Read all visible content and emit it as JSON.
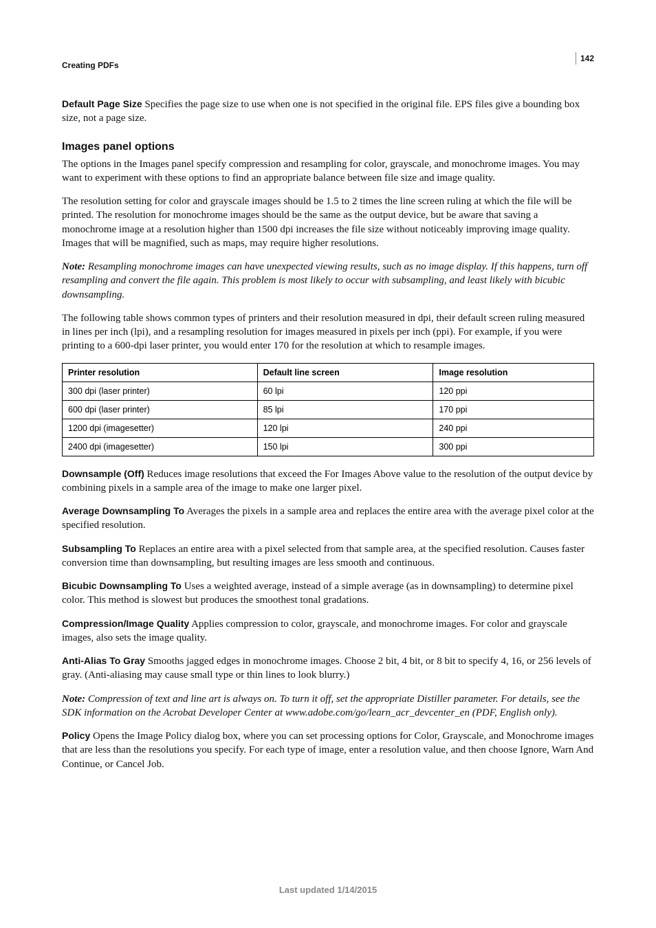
{
  "header": {
    "section": "Creating PDFs",
    "page_number": "142"
  },
  "defs": {
    "default_page_size": {
      "term": "Default Page Size",
      "body": "  Specifies the page size to use when one is not specified in the original file. EPS files give a bounding box size, not a page size."
    },
    "downsample_off": {
      "term": "Downsample (Off)",
      "body": "  Reduces image resolutions that exceed the For Images Above value to the resolution of the output device by combining pixels in a sample area of the image to make one larger pixel."
    },
    "average_downsampling": {
      "term": "Average Downsampling To",
      "body": "  Averages the pixels in a sample area and replaces the entire area with the average pixel color at the specified resolution."
    },
    "subsampling_to": {
      "term": "Subsampling To",
      "body": "  Replaces an entire area with a pixel selected from that sample area, at the specified resolution. Causes faster conversion time than downsampling, but resulting images are less smooth and continuous."
    },
    "bicubic_downsampling": {
      "term": "Bicubic Downsampling To",
      "body": "  Uses a weighted average, instead of a simple average (as in downsampling) to determine pixel color. This method is slowest but produces the smoothest tonal gradations."
    },
    "compression_quality": {
      "term": "Compression/Image Quality",
      "body": "  Applies compression to color, grayscale, and monochrome images. For color and grayscale images, also sets the image quality."
    },
    "antialias_to_gray": {
      "term": "Anti-Alias To Gray",
      "body": "  Smooths jagged edges in monochrome images. Choose 2 bit, 4 bit, or 8 bit to specify 4, 16, or 256 levels of gray. (Anti-aliasing may cause small type or thin lines to look blurry.)"
    },
    "policy": {
      "term": "Policy",
      "body": "  Opens the Image Policy dialog box, where you can set processing options for Color, Grayscale, and Monochrome images that are less than the resolutions you specify. For each type of image, enter a resolution value, and then choose Ignore, Warn And Continue, or Cancel Job."
    }
  },
  "images_panel": {
    "heading": "Images panel options",
    "p1": "The options in the Images panel specify compression and resampling for color, grayscale, and monochrome images. You may want to experiment with these options to find an appropriate balance between file size and image quality.",
    "p2": "The resolution setting for color and grayscale images should be 1.5 to 2 times the line screen ruling at which the file will be printed. The resolution for monochrome images should be the same as the output device, but be aware that saving a monochrome image at a resolution higher than 1500 dpi increases the file size without noticeably improving image quality. Images that will be magnified, such as maps, may require higher resolutions.",
    "note1_label": "Note:",
    "note1_body": " Resampling monochrome images can have unexpected viewing results, such as no image display. If this happens, turn off resampling and convert the file again. This problem is most likely to occur with subsampling, and least likely with bicubic downsampling.",
    "p3": "The following table shows common types of printers and their resolution measured in dpi, their default screen ruling measured in lines per inch (lpi), and a resampling resolution for images measured in pixels per inch (ppi). For example, if you were printing to a 600-dpi laser printer, you would enter 170 for the resolution at which to resample images."
  },
  "note2": {
    "label": "Note:",
    "body_pre": " Compression of text and line art is always on. To turn it off, set the appropriate Distiller parameter. For details, see the SDK information on the Acrobat Developer Center at ",
    "link": "www.adobe.com/go/learn_acr_devcenter_en",
    "body_post": " (PDF, English only)."
  },
  "table": {
    "headers": [
      "Printer resolution",
      "Default line screen",
      "Image resolution"
    ],
    "rows": [
      [
        "300 dpi (laser printer)",
        "60 lpi",
        "120 ppi"
      ],
      [
        "600 dpi (laser printer)",
        "85 lpi",
        "170 ppi"
      ],
      [
        "1200 dpi (imagesetter)",
        "120 lpi",
        "240 ppi"
      ],
      [
        "2400 dpi (imagesetter)",
        "150 lpi",
        "300 ppi"
      ]
    ]
  },
  "footer": "Last updated 1/14/2015",
  "chart_data": {
    "type": "table",
    "title": "Printer resolution vs default line screen vs image resolution",
    "columns": [
      "Printer resolution",
      "Default line screen",
      "Image resolution"
    ],
    "rows": [
      {
        "printer_resolution_dpi": 300,
        "device": "laser printer",
        "default_line_screen_lpi": 60,
        "image_resolution_ppi": 120
      },
      {
        "printer_resolution_dpi": 600,
        "device": "laser printer",
        "default_line_screen_lpi": 85,
        "image_resolution_ppi": 170
      },
      {
        "printer_resolution_dpi": 1200,
        "device": "imagesetter",
        "default_line_screen_lpi": 120,
        "image_resolution_ppi": 240
      },
      {
        "printer_resolution_dpi": 2400,
        "device": "imagesetter",
        "default_line_screen_lpi": 150,
        "image_resolution_ppi": 300
      }
    ]
  }
}
